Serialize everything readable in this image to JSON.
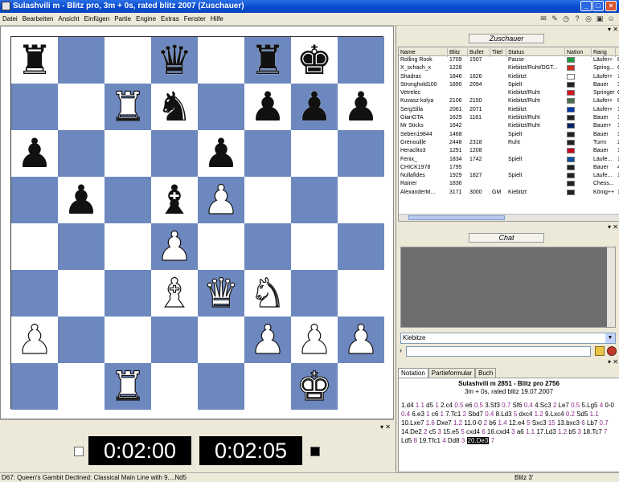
{
  "window": {
    "title": "Sulashvili m - Blitz pro, 3m + 0s, rated blitz 2007 (Zuschauer)"
  },
  "menu": [
    "Datei",
    "Bearbeiten",
    "Ansicht",
    "Einfügen",
    "Partie",
    "Engine",
    "Extras",
    "Fenster",
    "Hilfe"
  ],
  "toolbar_icons": [
    "chat-icon",
    "notes-icon",
    "clock-icon",
    "help-icon",
    "seek-icon",
    "lock-icon",
    "user-icon"
  ],
  "board": {
    "rows": [
      [
        "bR",
        "",
        "",
        "bQ",
        "",
        "bR",
        "bK",
        ""
      ],
      [
        "",
        "",
        "wR",
        "bN",
        "",
        "bP",
        "bP",
        "bP"
      ],
      [
        "bP",
        "",
        "",
        "",
        "bP",
        "",
        "",
        ""
      ],
      [
        "",
        "bP",
        "",
        "bB",
        "wP",
        "",
        "",
        ""
      ],
      [
        "",
        "",
        "",
        "wP",
        "",
        "",
        "",
        ""
      ],
      [
        "",
        "",
        "",
        "wB",
        "wQ",
        "wN",
        "",
        ""
      ],
      [
        "wP",
        "",
        "",
        "",
        "",
        "wP",
        "wP",
        "wP"
      ],
      [
        "",
        "",
        "wR",
        "",
        "",
        "",
        "wK",
        ""
      ]
    ]
  },
  "clocks": {
    "left": "0:02:00",
    "right": "0:02:05"
  },
  "status_bar": {
    "left": "D67: Queen's Gambit Declined: Classical Main Line with 9....Nd5",
    "right": "Blitz 3'"
  },
  "spectators": {
    "caption": "Zuschauer",
    "columns": [
      "Name",
      "Blitz",
      "Bullet",
      "Titel",
      "Status",
      "Nation",
      "Rang",
      ""
    ],
    "rows": [
      {
        "name": "Rolling Rook",
        "blitz": "1709",
        "bullet": "1507",
        "titel": "",
        "status": "Pause",
        "flag": "#1e9e3e",
        "rang": "Läufer+",
        "x": "8"
      },
      {
        "name": "X_schach_x",
        "blitz": "1228",
        "bullet": "",
        "titel": "",
        "status": "Kiebitzt/Ruht/DGT...",
        "flag": "#d52b1e",
        "rang": "Spring...",
        "x": "6"
      },
      {
        "name": "Shadrac",
        "blitz": "1846",
        "bullet": "1826",
        "titel": "",
        "status": "Kiebitzt",
        "flag": "#ffffff",
        "rang": "Läufer+",
        "x": "7"
      },
      {
        "name": "Stronghold100",
        "blitz": "1890",
        "bullet": "2094",
        "titel": "",
        "status": "Spielt",
        "flag": "#222222",
        "rang": "Bauer",
        "x": "3"
      },
      {
        "name": "Vetrelec",
        "blitz": "",
        "bullet": "",
        "titel": "",
        "status": "Kiebitzt/Ruht",
        "flag": "#d7141a",
        "rang": "Springer",
        "x": "6"
      },
      {
        "name": "Kuvasz kolya",
        "blitz": "2106",
        "bullet": "2150",
        "titel": "",
        "status": "Kiebitzt/Ruht",
        "flag": "#436f4d",
        "rang": "Läufer+",
        "x": "8"
      },
      {
        "name": "SergSilla",
        "blitz": "2061",
        "bullet": "2071",
        "titel": "",
        "status": "Kiebitzt",
        "flag": "#0039a6",
        "rang": "Läufer+",
        "x": "1"
      },
      {
        "name": "GianGTA",
        "blitz": "1629",
        "bullet": "1181",
        "titel": "",
        "status": "Kiebitzt/Ruht",
        "flag": "#222222",
        "rang": "Bauer",
        "x": "1"
      },
      {
        "name": "Mr Sticks",
        "blitz": "1642",
        "bullet": "",
        "titel": "",
        "status": "Kiebitzt/Ruht",
        "flag": "#012169",
        "rang": "Bauer+",
        "x": "1"
      },
      {
        "name": "Seben19844",
        "blitz": "1468",
        "bullet": "",
        "titel": "",
        "status": "Spielt",
        "flag": "#222222",
        "rang": "Bauer",
        "x": "3"
      },
      {
        "name": "Grenouille",
        "blitz": "2448",
        "bullet": "2318",
        "titel": "",
        "status": "Ruht",
        "flag": "#222222",
        "rang": "Turm",
        "x": "2"
      },
      {
        "name": "Heraclito3",
        "blitz": "1291",
        "bullet": "1208",
        "titel": "",
        "status": "",
        "flag": "#c60b1e",
        "rang": "Bauer",
        "x": "1"
      },
      {
        "name": "Fenix_",
        "blitz": "1834",
        "bullet": "1742",
        "titel": "",
        "status": "Spielt",
        "flag": "#0b4ea2",
        "rang": "Läufe...",
        "x": "1"
      },
      {
        "name": "CHICK1978",
        "blitz": "1795",
        "bullet": "",
        "titel": "",
        "status": "",
        "flag": "#222222",
        "rang": "Bauer",
        "x": "4"
      },
      {
        "name": "Nullafides",
        "blitz": "1929",
        "bullet": "1827",
        "titel": "",
        "status": "Spielt",
        "flag": "#222222",
        "rang": "Läufe...",
        "x": "1"
      },
      {
        "name": "Rainer",
        "blitz": "1836",
        "bullet": "",
        "titel": "",
        "status": "",
        "flag": "#222222",
        "rang": "Chess...",
        "x": ""
      },
      {
        "name": "AlexanderM...",
        "blitz": "3171",
        "bullet": "3000",
        "titel": "GM",
        "status": "Kiebitzt",
        "flag": "#222222",
        "rang": "König++",
        "x": "1"
      }
    ]
  },
  "chat": {
    "caption": "Chat",
    "channel": "Kiebitze",
    "input_value": ""
  },
  "notation_tabs": [
    "Notation",
    "Partieformular",
    "Buch"
  ],
  "game": {
    "line1": "Sulashvili m 2851 - Blitz pro 2756",
    "line2": "3m + 0s, rated blitz 19.07.2007"
  },
  "moves": [
    [
      "1.d4",
      "1.1"
    ],
    [
      "d5",
      "1"
    ],
    [
      "2.c4",
      "0.5"
    ],
    [
      "e6",
      "0.5"
    ],
    [
      "3.Sf3",
      "0.7"
    ],
    [
      "Sf6",
      "0.4"
    ],
    [
      "4.Sc3",
      "2"
    ],
    [
      "Le7",
      "0.5"
    ],
    [
      "5.Lg5",
      "4"
    ],
    [
      "0-0",
      "0.4"
    ],
    [
      "6.e3",
      "1"
    ],
    [
      "c6",
      "1"
    ],
    [
      "7.Tc1",
      "2"
    ],
    [
      "Sbd7",
      "0.4"
    ],
    [
      "8.Ld3",
      "5"
    ],
    [
      "dxc4",
      "1.2"
    ],
    [
      "9.Lxc4",
      "0.2"
    ],
    [
      "Sd5",
      "1.1"
    ],
    [
      "10.Lxe7",
      "1.6"
    ],
    [
      "Dxe7",
      "1.2"
    ],
    [
      "11.0-0",
      "2"
    ],
    [
      "b6",
      "1.4"
    ],
    [
      "12.e4",
      "5"
    ],
    [
      "Sxc3",
      "15"
    ],
    [
      "13.bxc3",
      "6"
    ],
    [
      "Lb7",
      "0.7"
    ],
    [
      "14.De2",
      "2"
    ],
    [
      "c5",
      "3"
    ],
    [
      "15.e5",
      "5"
    ],
    [
      "cxd4",
      "6"
    ],
    [
      "16.cxd4",
      "3"
    ],
    [
      "a6",
      "1.1"
    ],
    [
      "17.Ld3",
      "1.2"
    ],
    [
      "b5",
      "3"
    ],
    [
      "18.Tc7",
      "7"
    ],
    [
      "Ld5",
      "8"
    ],
    [
      "19.Tfc1",
      "4"
    ],
    [
      "Dd8",
      "3"
    ],
    [
      "20.De3",
      "7"
    ]
  ],
  "current_move_index": 38,
  "piece_glyphs": {
    "K": "♚",
    "Q": "♛",
    "R": "♜",
    "B": "♝",
    "N": "♞",
    "P": "♟"
  },
  "colors": {
    "light": "#ffffff",
    "dark": "#6c88bf"
  }
}
